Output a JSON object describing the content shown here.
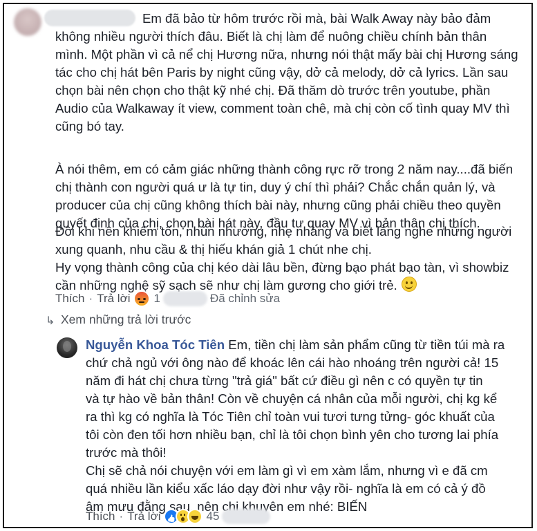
{
  "comment": {
    "lines1": [
      "Em đã bảo từ hôm trước rồi mà, bài Walk Away này bảo đảm",
      "không nhiều người thích đâu. Biết là chị làm để nuông chiều chính bản thân",
      "mình. Một phần vì cả nể chị Hương nữa, nhưng nói thật mấy bài chị Hương sáng",
      "tác cho chị hát bên Paris by night cũng vậy, dở cả melody, dở cả lyrics. Lần sau",
      "chọn bài nên chọn cho thật kỹ nhé chị. Đã thăm dò trước trên youtube, phần",
      "Audio của Walkaway ít view, comment toàn chê, mà chị còn cố tình quay MV thì",
      "cũng bó tay."
    ],
    "lines2": [
      "À nói thêm, em có cảm giác những thành công rực rỡ trong 2 năm nay....đã biến",
      "chị thành con người quá ư là tự tin, duy ý chí thì phải? Chắc chắn quản lý, và",
      "producer của chị cũng không thích bài này, nhưng cũng phải chiều theo quyền",
      "quyết định của chị, chọn bài hát này, đầu tư quay MV vì bản thân chị thích."
    ],
    "lines3": [
      "Đôi khi nên khiêm tốn, nhún nhường, nhẹ nhàng và biết lắng nghe những người",
      "xung quanh, nhu cầu & thị hiếu khán giả 1 chút nhe chị.",
      "Hy vọng thành công của chị kéo dài lâu bền, đừng bạo phát bạo tàn, vì showbiz",
      "cần những nghệ sỹ sạch sẽ như chị làm gương cho giới trẻ."
    ],
    "like_label": "Thích",
    "reply_label": "Trả lời",
    "separator": "·",
    "reaction_count": "1",
    "edited_label": "Đã chỉnh sửa",
    "reaction_icon": "angry-icon"
  },
  "view_more_replies": "Xem những trả lời trước",
  "reply": {
    "author": "Nguyễn Khoa Tóc Tiên",
    "first_line": "Em, tiền chị làm sản phẩm cũng từ tiền túi mà ra",
    "lines": [
      "chứ chả ngủ với ông nào để khoác lên cái hào nhoáng trên người cả! 15",
      "năm đi hát chị chưa từng \"trả giá\" bất cứ điều gì nên c có quyền tự tin",
      "và tự hào về bản thân! Còn về chuyện cá nhân của mỗi người, chị kg kể",
      "ra thì kg có nghĩa là Tóc Tiên chỉ toàn vui tươi tưng tửng- góc khuất của",
      "tôi còn đen tối hơn nhiều bạn, chỉ là tôi chọn bình yên cho tương lai phía",
      "trước mà thôi!",
      "Chị sẽ chả nói chuyện với em làm gì vì em xàm lắm, nhưng vì e đã cm",
      "quá nhiều lần kiểu xấc láo dạy đời như vậy rồi- nghĩa là em có cả ý đồ",
      "âm mưu đằng sau, nên chị khuyên em nhé: BIẾN"
    ],
    "like_label": "Thích",
    "reply_label": "Trả lời",
    "separator": "·",
    "reaction_count": "45",
    "reaction_icons": [
      "like-icon",
      "wow-icon",
      "haha-icon"
    ]
  }
}
